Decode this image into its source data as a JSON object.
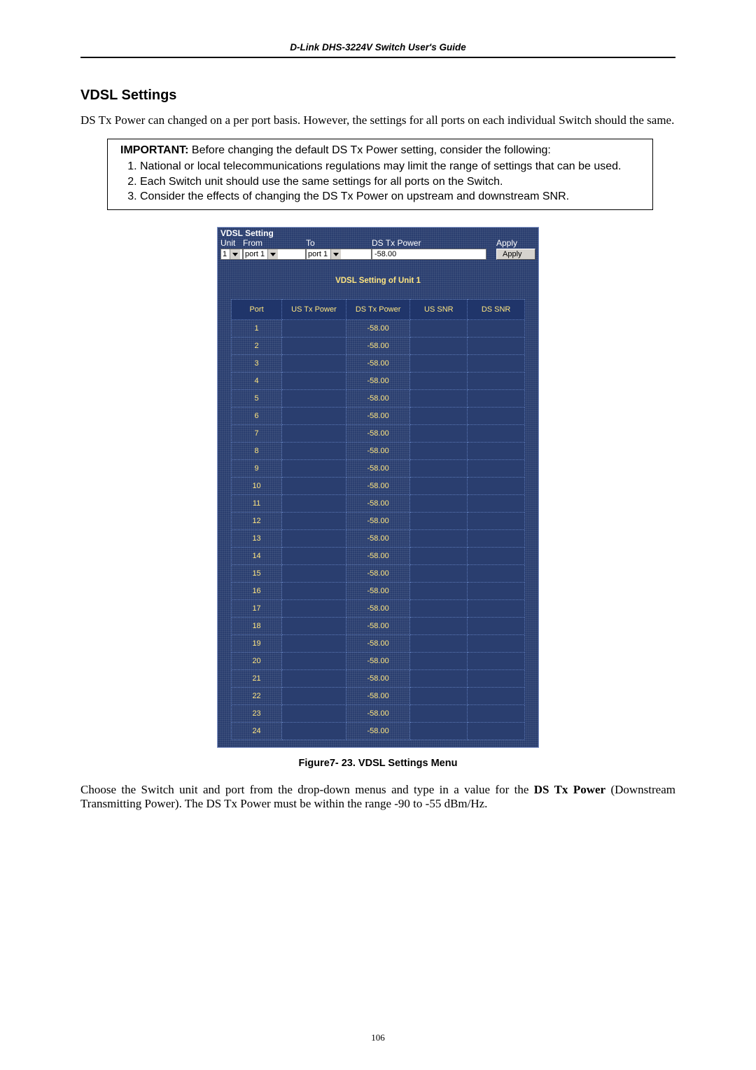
{
  "header": {
    "doc_title": "D-Link DHS-3224V Switch User's Guide"
  },
  "section": {
    "heading": "VDSL Settings",
    "intro": "DS Tx Power can changed on a per port basis. However, the settings for all ports on each individual Switch should the same."
  },
  "important": {
    "lead": "IMPORTANT:",
    "lead_tail": " Before changing the default DS Tx Power setting, consider the following:",
    "items": [
      "National or local telecommunications regulations may limit the range of settings that can be used.",
      "Each Switch unit should use the same settings for all ports on the Switch.",
      "Consider the effects of changing the DS Tx Power on upstream and downstream SNR."
    ]
  },
  "panel": {
    "title": "VDSL Setting",
    "labels": {
      "unit": "Unit",
      "from": "From",
      "to": "To",
      "ds_tx_power": "DS Tx Power",
      "apply": "Apply"
    },
    "unit_value": "1",
    "from_value": "port 1",
    "to_value": "port 1",
    "ds_value": "-58.00",
    "apply_btn": "Apply",
    "sub_caption": "VDSL Setting  of Unit 1",
    "columns": [
      "Port",
      "US Tx Power",
      "DS Tx Power",
      "US SNR",
      "DS SNR"
    ],
    "rows": [
      {
        "port": "1",
        "us": "",
        "ds": "-58.00",
        "us_snr": "",
        "ds_snr": ""
      },
      {
        "port": "2",
        "us": "",
        "ds": "-58.00",
        "us_snr": "",
        "ds_snr": ""
      },
      {
        "port": "3",
        "us": "",
        "ds": "-58.00",
        "us_snr": "",
        "ds_snr": ""
      },
      {
        "port": "4",
        "us": "",
        "ds": "-58.00",
        "us_snr": "",
        "ds_snr": ""
      },
      {
        "port": "5",
        "us": "",
        "ds": "-58.00",
        "us_snr": "",
        "ds_snr": ""
      },
      {
        "port": "6",
        "us": "",
        "ds": "-58.00",
        "us_snr": "",
        "ds_snr": ""
      },
      {
        "port": "7",
        "us": "",
        "ds": "-58.00",
        "us_snr": "",
        "ds_snr": ""
      },
      {
        "port": "8",
        "us": "",
        "ds": "-58.00",
        "us_snr": "",
        "ds_snr": ""
      },
      {
        "port": "9",
        "us": "",
        "ds": "-58.00",
        "us_snr": "",
        "ds_snr": ""
      },
      {
        "port": "10",
        "us": "",
        "ds": "-58.00",
        "us_snr": "",
        "ds_snr": ""
      },
      {
        "port": "11",
        "us": "",
        "ds": "-58.00",
        "us_snr": "",
        "ds_snr": ""
      },
      {
        "port": "12",
        "us": "",
        "ds": "-58.00",
        "us_snr": "",
        "ds_snr": ""
      },
      {
        "port": "13",
        "us": "",
        "ds": "-58.00",
        "us_snr": "",
        "ds_snr": ""
      },
      {
        "port": "14",
        "us": "",
        "ds": "-58.00",
        "us_snr": "",
        "ds_snr": ""
      },
      {
        "port": "15",
        "us": "",
        "ds": "-58.00",
        "us_snr": "",
        "ds_snr": ""
      },
      {
        "port": "16",
        "us": "",
        "ds": "-58.00",
        "us_snr": "",
        "ds_snr": ""
      },
      {
        "port": "17",
        "us": "",
        "ds": "-58.00",
        "us_snr": "",
        "ds_snr": ""
      },
      {
        "port": "18",
        "us": "",
        "ds": "-58.00",
        "us_snr": "",
        "ds_snr": ""
      },
      {
        "port": "19",
        "us": "",
        "ds": "-58.00",
        "us_snr": "",
        "ds_snr": ""
      },
      {
        "port": "20",
        "us": "",
        "ds": "-58.00",
        "us_snr": "",
        "ds_snr": ""
      },
      {
        "port": "21",
        "us": "",
        "ds": "-58.00",
        "us_snr": "",
        "ds_snr": ""
      },
      {
        "port": "22",
        "us": "",
        "ds": "-58.00",
        "us_snr": "",
        "ds_snr": ""
      },
      {
        "port": "23",
        "us": "",
        "ds": "-58.00",
        "us_snr": "",
        "ds_snr": ""
      },
      {
        "port": "24",
        "us": "",
        "ds": "-58.00",
        "us_snr": "",
        "ds_snr": ""
      }
    ]
  },
  "figure_caption": "Figure7- 23. VDSL Settings Menu",
  "closing": {
    "pre": "Choose the Switch unit and port from the drop-down menus and type in a value for the ",
    "bold": "DS Tx Power",
    "post": " (Downstream Transmitting Power). The DS Tx Power must be within the range -90 to -55 dBm/Hz."
  },
  "page_number": "106"
}
